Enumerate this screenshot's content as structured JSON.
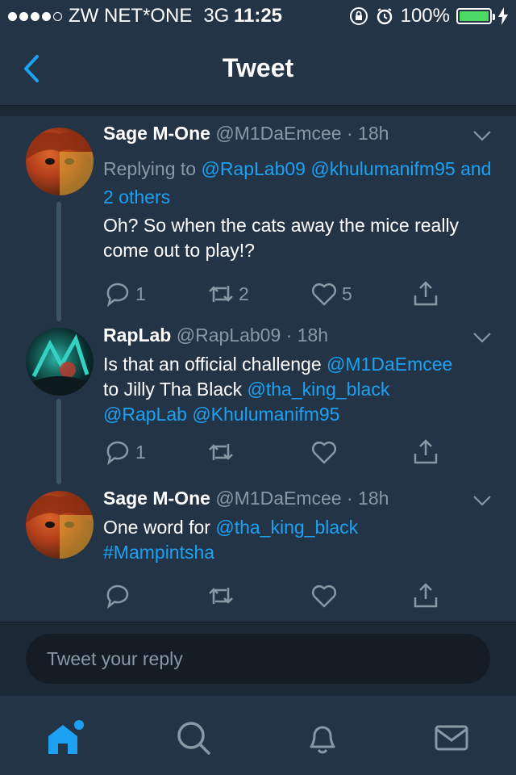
{
  "status_bar": {
    "carrier": "ZW NET*ONE",
    "network": "3G",
    "time": "11:25",
    "battery": "100%",
    "battery_level": 1.0
  },
  "nav": {
    "title": "Tweet"
  },
  "tweets": [
    {
      "name": "Sage M-One",
      "handle": "@M1DaEmcee",
      "time": "· 18h",
      "reply_prefix": "Replying to",
      "reply_mentions": [
        "@RapLab09",
        "@khulumanifm95"
      ],
      "reply_more": "and 2 others",
      "text": "Oh? So when the cats away the mice really come out to play!?",
      "reply_count": "1",
      "retweet_count": "2",
      "like_count": "5"
    },
    {
      "name": "RapLab",
      "handle": "@RapLab09",
      "time": "· 18h",
      "text_1": "Is that an official challenge ",
      "mention_1": "@M1DaEmcee",
      "text_2": "to Jilly Tha Black ",
      "mention_2": "@tha_king_black",
      "mention_3": "@RapLab",
      "mention_4": "@Khulumanifm95",
      "reply_count": "1",
      "retweet_count": "",
      "like_count": ""
    },
    {
      "name": "Sage M-One",
      "handle": "@M1DaEmcee",
      "time": "· 18h",
      "text_1": "One word for ",
      "mention_1": "@tha_king_black",
      "hashtag": "#Mampintsha",
      "reply_count": "",
      "retweet_count": "",
      "like_count": ""
    }
  ],
  "reply_box": {
    "placeholder": "Tweet your reply"
  },
  "tab_bar": {
    "active_color": "#1da1f2",
    "inactive_color": "#8899a6",
    "items": [
      "home-icon",
      "search-icon",
      "notifications-icon",
      "messages-icon"
    ]
  }
}
